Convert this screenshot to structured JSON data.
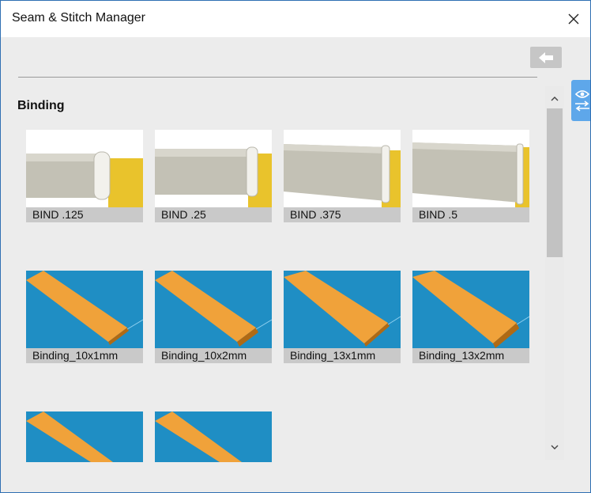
{
  "window": {
    "title": "Seam & Stitch Manager"
  },
  "icons": {
    "close": "close-icon",
    "back": "back-arrow-icon",
    "side_tab": "eye-swap-icon",
    "scroll_up": "chevron-up-icon",
    "scroll_down": "chevron-down-icon"
  },
  "section": {
    "heading": "Binding"
  },
  "items": [
    {
      "label": "BIND .125",
      "style": "profile"
    },
    {
      "label": "BIND .25",
      "style": "profile"
    },
    {
      "label": "BIND .375",
      "style": "profile"
    },
    {
      "label": "BIND .5",
      "style": "profile"
    },
    {
      "label": "Binding_10x1mm",
      "style": "tape"
    },
    {
      "label": "Binding_10x2mm",
      "style": "tape"
    },
    {
      "label": "Binding_13x1mm",
      "style": "tape"
    },
    {
      "label": "Binding_13x2mm",
      "style": "tape"
    },
    {
      "label": "",
      "style": "tape"
    },
    {
      "label": "",
      "style": "tape"
    }
  ],
  "colors": {
    "accent": "#5ea7ea",
    "tape_orange": "#f0a23a",
    "tape_background": "#1f8ec4",
    "binding_yellow": "#e9c32c",
    "binding_gray": "#c3c1b5"
  }
}
